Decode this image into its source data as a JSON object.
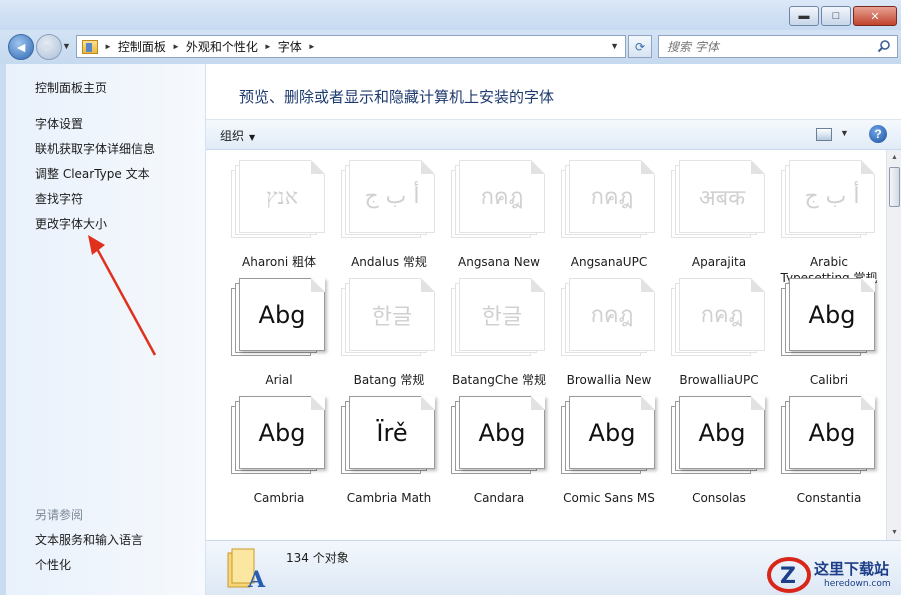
{
  "window": {
    "minimize_glyph": "▬",
    "maximize_glyph": "□",
    "close_glyph": "✕"
  },
  "nav": {
    "back_glyph": "◄",
    "forward_glyph": "►",
    "breadcrumbs": [
      "控制面板",
      "外观和个性化",
      "字体"
    ],
    "search_placeholder": "搜索 字体"
  },
  "left_pane": {
    "home": "控制面板主页",
    "links": [
      "字体设置",
      "联机获取字体详细信息",
      "调整 ClearType 文本",
      "查找字符",
      "更改字体大小"
    ],
    "see_also_heading": "另请参阅",
    "see_also": [
      "文本服务和输入语言",
      "个性化"
    ]
  },
  "main": {
    "headline": "预览、删除或者显示和隐藏计算机上安装的字体",
    "toolbar": {
      "organize": "组织",
      "help_glyph": "?"
    },
    "fonts": [
      {
        "name": "Aharoni 粗体",
        "sample": "אנץ",
        "style": "faded"
      },
      {
        "name": "Andalus 常规",
        "sample": "أ ب ج",
        "style": "faded"
      },
      {
        "name": "Angsana New",
        "sample": "กคฎ",
        "style": "faded"
      },
      {
        "name": "AngsanaUPC",
        "sample": "กคฎ",
        "style": "faded"
      },
      {
        "name": "Aparajita",
        "sample": "अबक",
        "style": "faded"
      },
      {
        "name": "Arabic Typesetting 常规",
        "sample": "أ ب ج",
        "style": "faded"
      },
      {
        "name": "Arial",
        "sample": "Abg",
        "style": "bold"
      },
      {
        "name": "Batang 常规",
        "sample": "한글",
        "style": "faded"
      },
      {
        "name": "BatangChe 常规",
        "sample": "한글",
        "style": "faded"
      },
      {
        "name": "Browallia New",
        "sample": "กคฎ",
        "style": "faded"
      },
      {
        "name": "BrowalliaUPC",
        "sample": "กคฎ",
        "style": "faded"
      },
      {
        "name": "Calibri",
        "sample": "Abg",
        "style": "bold"
      },
      {
        "name": "Cambria",
        "sample": "Abg",
        "style": "bold"
      },
      {
        "name": "Cambria Math",
        "sample": "Ïrě",
        "style": "bold"
      },
      {
        "name": "Candara",
        "sample": "Abg",
        "style": "bold"
      },
      {
        "name": "Comic Sans MS",
        "sample": "Abg",
        "style": "bold"
      },
      {
        "name": "Consolas",
        "sample": "Abg",
        "style": "bold"
      },
      {
        "name": "Constantia",
        "sample": "Abg",
        "style": "bold"
      }
    ],
    "status": {
      "count": "134 个对象"
    }
  },
  "watermark": {
    "text": "这里下载站",
    "sub": "heredown.com"
  }
}
